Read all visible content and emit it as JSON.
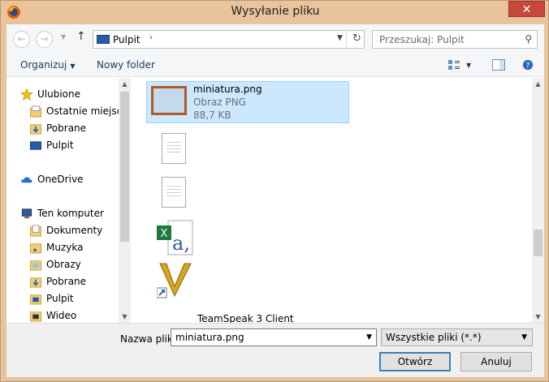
{
  "window": {
    "title": "Wysyłanie pliku",
    "close": "✕"
  },
  "nav": {
    "back": "←",
    "forward": "→",
    "up": "↑"
  },
  "address": {
    "location": "Pulpit",
    "separator": "›"
  },
  "search": {
    "placeholder": "Przeszukaj: Pulpit"
  },
  "toolbar": {
    "organize": "Organizuj",
    "new_folder": "Nowy folder"
  },
  "sidebar": {
    "favorites": "Ulubione",
    "items_fav": [
      "Ostatnie miejsca",
      "Pobrane",
      "Pulpit"
    ],
    "onedrive": "OneDrive",
    "computer": "Ten komputer",
    "items_pc": [
      "Dokumenty",
      "Muzyka",
      "Obrazy",
      "Pobrane",
      "Pulpit",
      "Wideo"
    ]
  },
  "files": {
    "selected": {
      "name": "miniatura.png",
      "type": "Obraz PNG",
      "size": "88,7 KB"
    },
    "partial_label": "TeamSpeak 3 Client"
  },
  "footer": {
    "filename_label": "Nazwa pliku:",
    "filename_value": "miniatura.png",
    "filter": "Wszystkie pliki (*.*)",
    "open": "Otwórz",
    "cancel": "Anuluj"
  },
  "colors": {
    "frame": "#e8c39b",
    "close": "#c7483b",
    "selection": "#cce8ff",
    "selection_border": "#99d1ff"
  }
}
